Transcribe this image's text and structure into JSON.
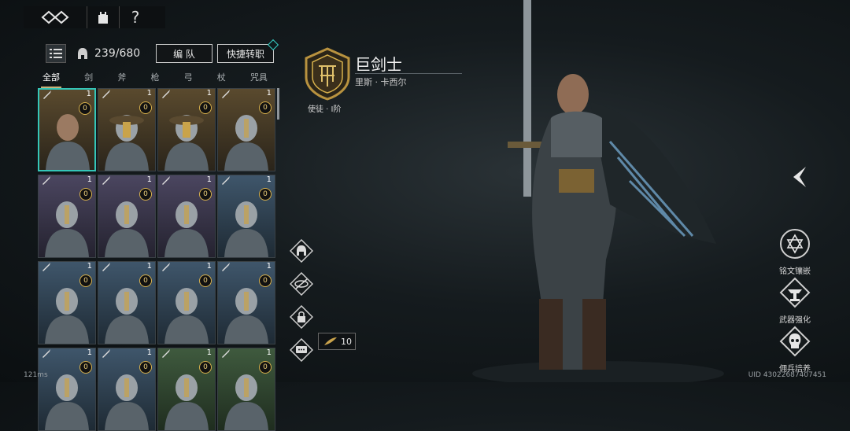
{
  "nav": {
    "help_label": "?"
  },
  "roster": {
    "count": "239/680",
    "team_label": "编 队",
    "quick_label": "快捷转职",
    "tabs": [
      "全部",
      "剑",
      "斧",
      "枪",
      "弓",
      "杖",
      "咒具"
    ],
    "active_tab": 0,
    "cards": [
      {
        "level": "1",
        "grade": "0",
        "theme": "gold",
        "hat": "none"
      },
      {
        "level": "1",
        "grade": "0",
        "theme": "gold",
        "hat": "mask"
      },
      {
        "level": "1",
        "grade": "0",
        "theme": "gold",
        "hat": "mask"
      },
      {
        "level": "1",
        "grade": "0",
        "theme": "gold",
        "hat": "helm"
      },
      {
        "level": "1",
        "grade": "0",
        "theme": "purple",
        "hat": "helm"
      },
      {
        "level": "1",
        "grade": "0",
        "theme": "purple",
        "hat": "helm"
      },
      {
        "level": "1",
        "grade": "0",
        "theme": "purple",
        "hat": "helm"
      },
      {
        "level": "1",
        "grade": "0",
        "theme": "blue",
        "hat": "helm"
      },
      {
        "level": "1",
        "grade": "0",
        "theme": "blue",
        "hat": "helm"
      },
      {
        "level": "1",
        "grade": "0",
        "theme": "blue",
        "hat": "helm"
      },
      {
        "level": "1",
        "grade": "0",
        "theme": "blue",
        "hat": "helm"
      },
      {
        "level": "1",
        "grade": "0",
        "theme": "blue",
        "hat": "helm"
      },
      {
        "level": "1",
        "grade": "0",
        "theme": "blue",
        "hat": "helm"
      },
      {
        "level": "1",
        "grade": "0",
        "theme": "blue",
        "hat": "helm"
      },
      {
        "level": "1",
        "grade": "0",
        "theme": "green",
        "hat": "helm"
      },
      {
        "level": "1",
        "grade": "0",
        "theme": "green",
        "hat": "helm"
      }
    ]
  },
  "hero": {
    "class_name": "巨剑士",
    "character_name": "里斯 · 卡西尔",
    "rank": "使徒 · Ⅰ阶"
  },
  "crit_count": "10",
  "menu": {
    "inscription": "铭文镶嵌",
    "weapon": "武器强化",
    "train": "佣兵培养"
  },
  "status": {
    "ping": "121ms",
    "uid": "UID 43022687407451"
  },
  "colors": {
    "accent": "#34c6b8",
    "gold": "#d8b14c"
  }
}
